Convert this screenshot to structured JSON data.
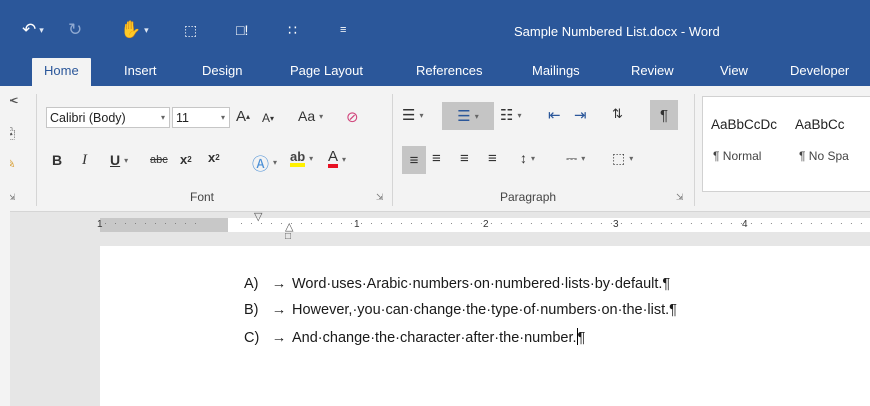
{
  "window": {
    "title": "Sample Numbered List.docx - Word"
  },
  "colors": {
    "accent": "#2b579a",
    "ribbon_bg": "#f3f3f3",
    "font_color_red": "#e81123",
    "highlight_yellow": "#fff100"
  },
  "qat": {
    "undo_icon": "undo-icon",
    "redo_icon": "redo-icon",
    "touch_mode_icon": "touch-mode-icon",
    "customize_icon": "customize-qat-icon"
  },
  "tabs": [
    {
      "label": "Home"
    },
    {
      "label": "Insert"
    },
    {
      "label": "Design"
    },
    {
      "label": "Page Layout"
    },
    {
      "label": "References"
    },
    {
      "label": "Mailings"
    },
    {
      "label": "Review"
    },
    {
      "label": "View"
    },
    {
      "label": "Developer"
    }
  ],
  "font_group": {
    "font_name": "Calibri (Body)",
    "font_size": "11",
    "label": "Font",
    "case_label": "Aa",
    "bold": "B",
    "italic": "I",
    "underline": "U",
    "strikethrough": "abc",
    "subscript": "x",
    "subscript_sub": "2",
    "superscript": "x",
    "superscript_sup": "2"
  },
  "paragraph_group": {
    "label": "Paragraph"
  },
  "styles": [
    {
      "sample": "AaBbCcDc",
      "name": "¶ Normal"
    },
    {
      "sample": "AaBbCc",
      "name": "¶ No Spa"
    }
  ],
  "ruler": {
    "numbers": [
      "1",
      "1",
      "2",
      "3",
      "4"
    ]
  },
  "document": {
    "lines": [
      {
        "label": "A)",
        "text": "Word·uses·Arabic·numbers·on·numbered·lists·by·default.¶"
      },
      {
        "label": "B)",
        "text": "However,·you·can·change·the·type·of·numbers·on·the·list.¶"
      },
      {
        "label": "C)",
        "text": "And·change·the·character·after·the·number.",
        "end": "¶"
      }
    ]
  }
}
